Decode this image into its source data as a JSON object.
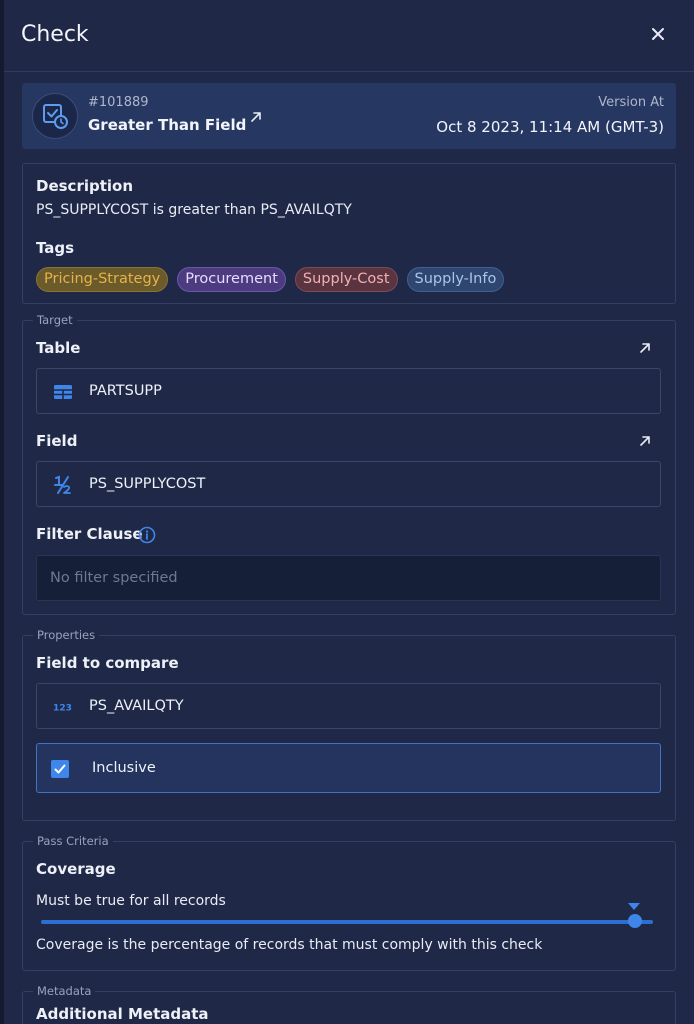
{
  "header": {
    "title": "Check"
  },
  "check": {
    "id": "#101889",
    "name": "Greater Than Field",
    "version_label": "Version At",
    "version_value": "Oct 8 2023, 11:14 AM (GMT-3)"
  },
  "description": {
    "label": "Description",
    "text": "PS_SUPPLYCOST is greater than PS_AVAILQTY"
  },
  "tags": {
    "label": "Tags",
    "items": [
      {
        "text": "Pricing-Strategy",
        "bg": "#6b5a2a",
        "fg": "#e6b24a",
        "border": "#8a7335"
      },
      {
        "text": "Procurement",
        "bg": "#4d3b80",
        "fg": "#e6dcff",
        "border": "#6b56ad"
      },
      {
        "text": "Supply-Cost",
        "bg": "#5a3540",
        "fg": "#f3b0b3",
        "border": "#7d4a55"
      },
      {
        "text": "Supply-Info",
        "bg": "#2e4670",
        "fg": "#a9c4ee",
        "border": "#40608f"
      }
    ]
  },
  "target": {
    "legend": "Target",
    "table_label": "Table",
    "table_value": "PARTSUPP",
    "field_label": "Field",
    "field_value": "PS_SUPPLYCOST",
    "filter_label": "Filter Clause",
    "filter_placeholder": "No filter specified"
  },
  "properties": {
    "legend": "Properties",
    "compare_label": "Field to compare",
    "compare_value": "PS_AVAILQTY",
    "inclusive_label": "Inclusive",
    "inclusive_checked": true
  },
  "pass_criteria": {
    "legend": "Pass Criteria",
    "coverage_label": "Coverage",
    "coverage_value": "Must be true for all records",
    "coverage_percent": 100,
    "coverage_help": "Coverage is the percentage of records that must comply with this check"
  },
  "metadata": {
    "legend": "Metadata",
    "additional_label": "Additional Metadata"
  },
  "icons": {
    "close": "close-icon",
    "check": "check-clock-icon",
    "external": "external-link-icon",
    "table": "table-icon",
    "fraction": "fraction-icon",
    "number": "number-icon",
    "info": "info-icon",
    "checkbox": "checkmark-icon"
  },
  "colors": {
    "accent": "#3f86ea",
    "panel": "#1f2947",
    "card": "#263762"
  }
}
